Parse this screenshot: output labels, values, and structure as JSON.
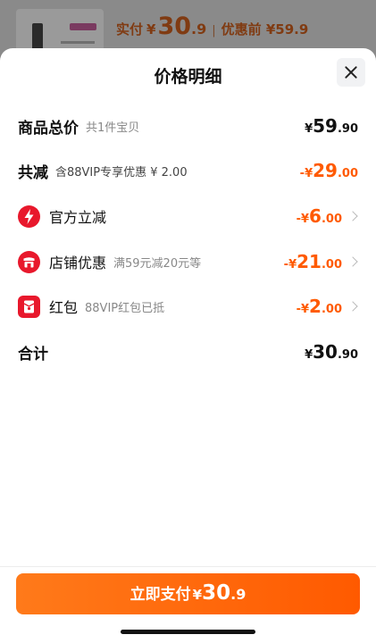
{
  "background": {
    "paid_label": "实付",
    "currency": "¥",
    "paid_int": "30",
    "paid_dec": ".9",
    "separator": "|",
    "original_label": "优惠前 ¥59.9"
  },
  "sheet": {
    "title": "价格明细"
  },
  "rows": {
    "total": {
      "label": "商品总价",
      "note": "共1件宝贝",
      "currency": "¥",
      "int": "59",
      "dec": ".90"
    },
    "discount": {
      "label": "共减",
      "note": "含88VIP专享优惠 ¥ 2.00",
      "currency": "-¥",
      "int": "29",
      "dec": ".00"
    },
    "official": {
      "label": "官方立减",
      "note": "",
      "currency": "-¥",
      "int": "6",
      "dec": ".00"
    },
    "store": {
      "label": "店铺优惠",
      "note": "满59元减20元等",
      "currency": "-¥",
      "int": "21",
      "dec": ".00"
    },
    "redpacket": {
      "label": "红包",
      "note": "88VIP红包已抵",
      "currency": "-¥",
      "int": "2",
      "dec": ".00"
    },
    "sum": {
      "label": "合计",
      "currency": "¥",
      "int": "30",
      "dec": ".90"
    }
  },
  "footer": {
    "pay_label": "立即支付",
    "currency": "¥",
    "int": "30",
    "dec": ".9"
  },
  "colors": {
    "accent": "#ff5a00",
    "icon_red": "#e8182c"
  },
  "icons": [
    "close-icon",
    "lightning-icon",
    "shop-icon",
    "red-packet-icon",
    "chevron-right-icon"
  ]
}
